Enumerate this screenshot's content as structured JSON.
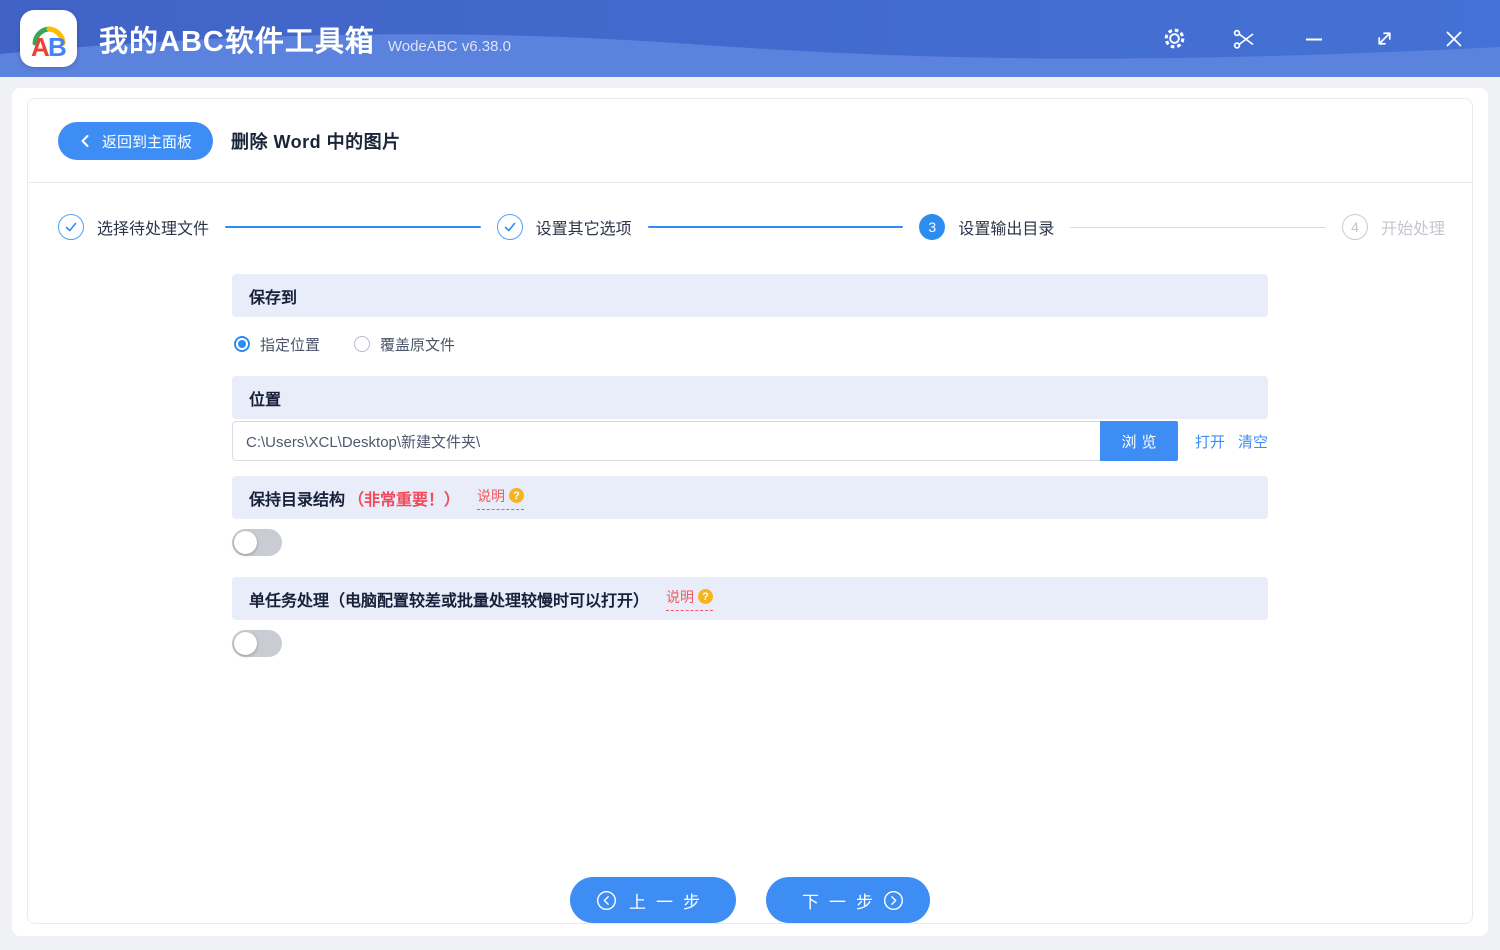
{
  "titlebar": {
    "logo_text_a": "A",
    "logo_text_b": "B",
    "app_title": "我的ABC软件工具箱",
    "version": "WodeABC v6.38.0",
    "icons": {
      "settings": "gear-icon",
      "screenshot": "scissors-icon",
      "minimize": "minus-icon",
      "maximize": "diagonal-resize-icon",
      "close": "x-icon"
    }
  },
  "header": {
    "back_label": "返回到主面板",
    "page_title": "删除 Word 中的图片"
  },
  "stepper": {
    "steps": [
      {
        "label": "选择待处理文件",
        "state": "done"
      },
      {
        "label": "设置其它选项",
        "state": "done"
      },
      {
        "label": "设置输出目录",
        "state": "current",
        "number": "3"
      },
      {
        "label": "开始处理",
        "state": "pending",
        "number": "4"
      }
    ]
  },
  "save_to": {
    "title": "保存到",
    "options": [
      {
        "label": "指定位置",
        "selected": true
      },
      {
        "label": "覆盖原文件",
        "selected": false
      }
    ]
  },
  "location": {
    "title": "位置",
    "path_value": "C:\\Users\\XCL\\Desktop\\新建文件夹\\",
    "browse_label": "浏览",
    "open_label": "打开",
    "clear_label": "清空"
  },
  "keep_structure": {
    "title": "保持目录结构",
    "important_note": "（非常重要！）",
    "help_label": "说明",
    "help_badge": "?",
    "enabled": false
  },
  "single_task": {
    "title": "单任务处理（电脑配置较差或批量处理较慢时可以打开）",
    "help_label": "说明",
    "help_badge": "?",
    "enabled": false
  },
  "footer": {
    "prev_label": "上一步",
    "next_label": "下一步"
  },
  "colors": {
    "titlebar_blue": "#4468d0",
    "titlebar_wave": "#5b82dc",
    "accent_blue": "#3d8df5",
    "stepper_blue": "#2d8cf0",
    "section_bar_bg": "#e9edf9",
    "danger_red": "#f2495a",
    "warning_orange": "#f6b51e",
    "toggle_off_gray": "#c9ccd2"
  }
}
